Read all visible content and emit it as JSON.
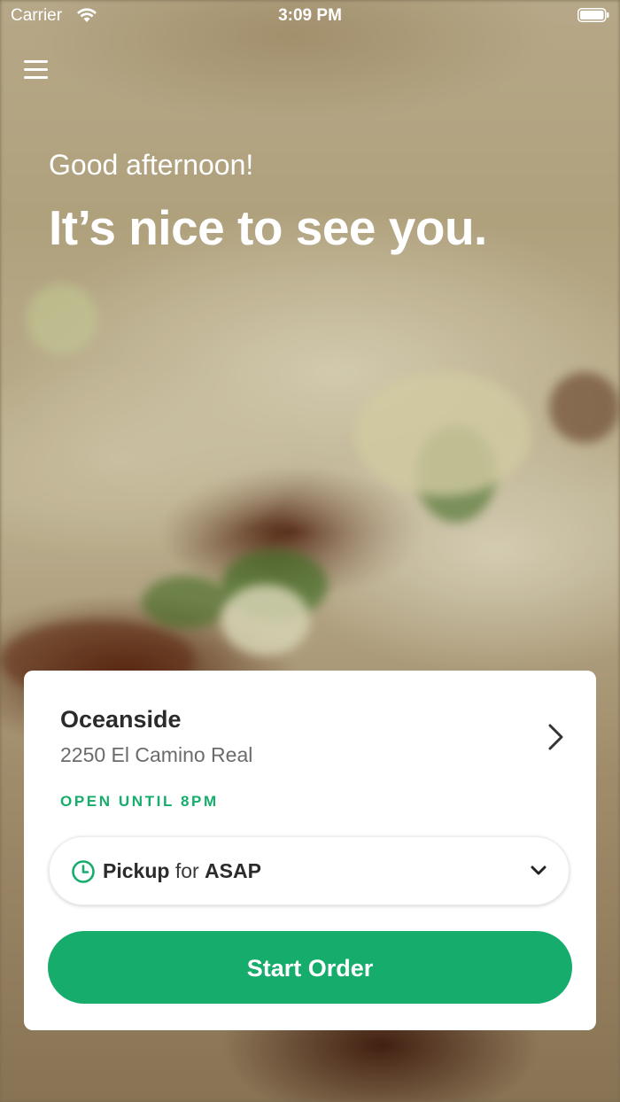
{
  "status_bar": {
    "carrier": "Carrier",
    "time": "3:09 PM",
    "wifi_icon": "wifi-icon",
    "battery_icon": "battery-icon"
  },
  "menu": {
    "icon": "hamburger-menu-icon"
  },
  "hero": {
    "greeting": "Good afternoon!",
    "headline": "It’s nice to see you."
  },
  "location_card": {
    "name": "Oceanside",
    "address": "2250 El Camino Real",
    "hours_status": "OPEN UNTIL 8PM",
    "chevron_icon": "chevron-right-icon"
  },
  "order_mode": {
    "icon": "clock-icon",
    "mode": "Pickup",
    "connector": "for",
    "time": "ASAP",
    "dropdown_icon": "chevron-down-icon"
  },
  "start_button": {
    "label": "Start Order"
  },
  "colors": {
    "accent": "#16ac6c",
    "card_background": "#ffffff",
    "text_primary": "#2b2b2b",
    "text_secondary": "#6b6b6b"
  }
}
